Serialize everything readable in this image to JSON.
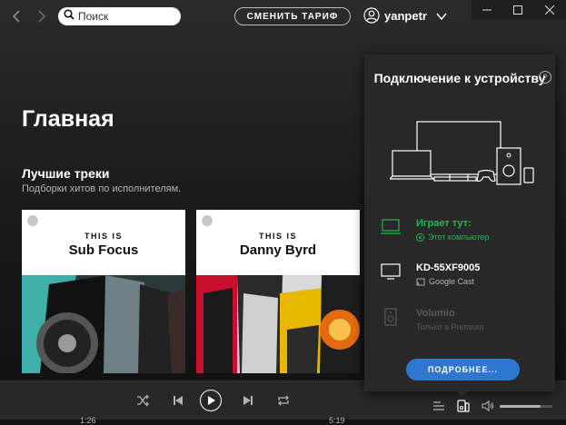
{
  "search": {
    "placeholder": "Поиск"
  },
  "header": {
    "upgrade_label": "СМЕНИТЬ ТАРИФ",
    "username": "yanpetr"
  },
  "main": {
    "title": "Главная",
    "section": {
      "title": "Лучшие треки",
      "subtitle": "Подборки хитов по исполнителям.",
      "cards": [
        {
          "prefix": "THIS IS",
          "artist": "Sub Focus"
        },
        {
          "prefix": "THIS IS",
          "artist": "Danny Byrd"
        }
      ]
    }
  },
  "device_popup": {
    "title": "Подключение к устройству",
    "help_symbol": "?",
    "devices": [
      {
        "name": "Играет тут:",
        "subtitle": "Этот компьютер",
        "state": "active",
        "icon": "laptop-icon"
      },
      {
        "name": "KD-55XF9005",
        "subtitle": "Google Cast",
        "state": "available",
        "icon": "tv-icon"
      },
      {
        "name": "Volumio",
        "subtitle": "Только в Premium",
        "state": "disabled",
        "icon": "speaker-icon"
      }
    ],
    "more_label": "ПОДРОБНЕЕ..."
  },
  "player": {
    "time_elapsed": "1:26",
    "time_total": "5:19",
    "volume": 0.78
  },
  "colors": {
    "accent_green": "#1db954",
    "button_blue": "#2e77d0",
    "popup_bg": "#282828"
  }
}
